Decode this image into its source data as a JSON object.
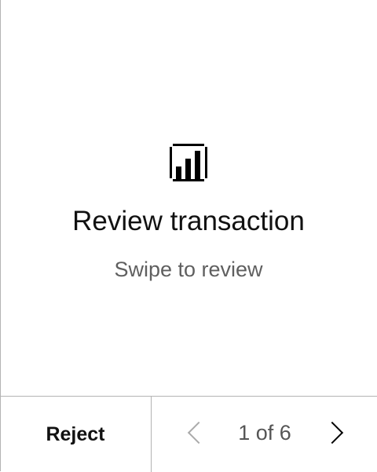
{
  "card": {
    "icon": "bar-chart-icon",
    "title": "Review transaction",
    "subtitle": "Swipe to review"
  },
  "footer": {
    "reject_label": "Reject",
    "page_indicator": "1 of 6",
    "prev_icon": "chevron-left-icon",
    "next_icon": "chevron-right-icon"
  }
}
